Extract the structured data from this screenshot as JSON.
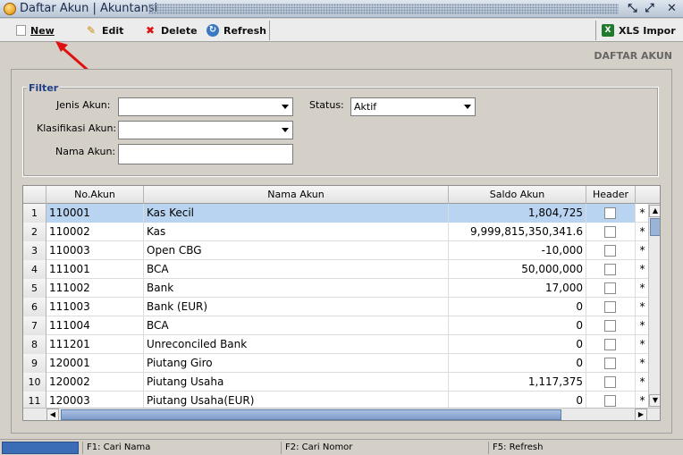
{
  "window": {
    "title": "Daftar Akun | Akuntansi",
    "icon": "app-coin-icon",
    "controls": [
      "restore-icon",
      "maximize-icon",
      "close-icon"
    ]
  },
  "toolbar": {
    "new_label": "New",
    "edit_label": "Edit",
    "delete_label": "Delete",
    "refresh_label": "Refresh",
    "xls_label": "XLS Impor"
  },
  "page_heading": "DAFTAR AKUN",
  "filter": {
    "legend": "Filter",
    "jenis_akun_label": "Jenis Akun:",
    "jenis_akun_value": "",
    "status_label": "Status:",
    "status_value": "Aktif",
    "klasifikasi_label": "Klasifikasi Akun:",
    "klasifikasi_value": "",
    "nama_akun_label": "Nama Akun:",
    "nama_akun_value": ""
  },
  "grid": {
    "columns": [
      "No.Akun",
      "Nama Akun",
      "Saldo Akun",
      "Header"
    ],
    "rows": [
      {
        "idx": "1",
        "no": "110001",
        "nama": "Kas Kecil",
        "saldo": "1,804,725",
        "extra": "*",
        "selected": true
      },
      {
        "idx": "2",
        "no": "110002",
        "nama": "Kas",
        "saldo": "9,999,815,350,341.6",
        "extra": "*"
      },
      {
        "idx": "3",
        "no": "110003",
        "nama": "Open CBG",
        "saldo": "-10,000",
        "extra": "*"
      },
      {
        "idx": "4",
        "no": "111001",
        "nama": "BCA",
        "saldo": "50,000,000",
        "extra": "*"
      },
      {
        "idx": "5",
        "no": "111002",
        "nama": "Bank",
        "saldo": "17,000",
        "extra": "*"
      },
      {
        "idx": "6",
        "no": "111003",
        "nama": "Bank (EUR)",
        "saldo": "0",
        "extra": "*"
      },
      {
        "idx": "7",
        "no": "111004",
        "nama": "BCA",
        "saldo": "0",
        "extra": "*"
      },
      {
        "idx": "8",
        "no": "111201",
        "nama": "Unreconciled Bank",
        "saldo": "0",
        "extra": "*"
      },
      {
        "idx": "9",
        "no": "120001",
        "nama": "Piutang Giro",
        "saldo": "0",
        "extra": "*"
      },
      {
        "idx": "10",
        "no": "120002",
        "nama": "Piutang Usaha",
        "saldo": "1,117,375",
        "extra": "*"
      },
      {
        "idx": "11",
        "no": "120003",
        "nama": "Piutang Usaha(EUR)",
        "saldo": "0",
        "extra": "*"
      }
    ]
  },
  "statusbar": {
    "f1": "F1: Cari Nama",
    "f2": "F2: Cari Nomor",
    "f5": "F5: Refresh"
  }
}
